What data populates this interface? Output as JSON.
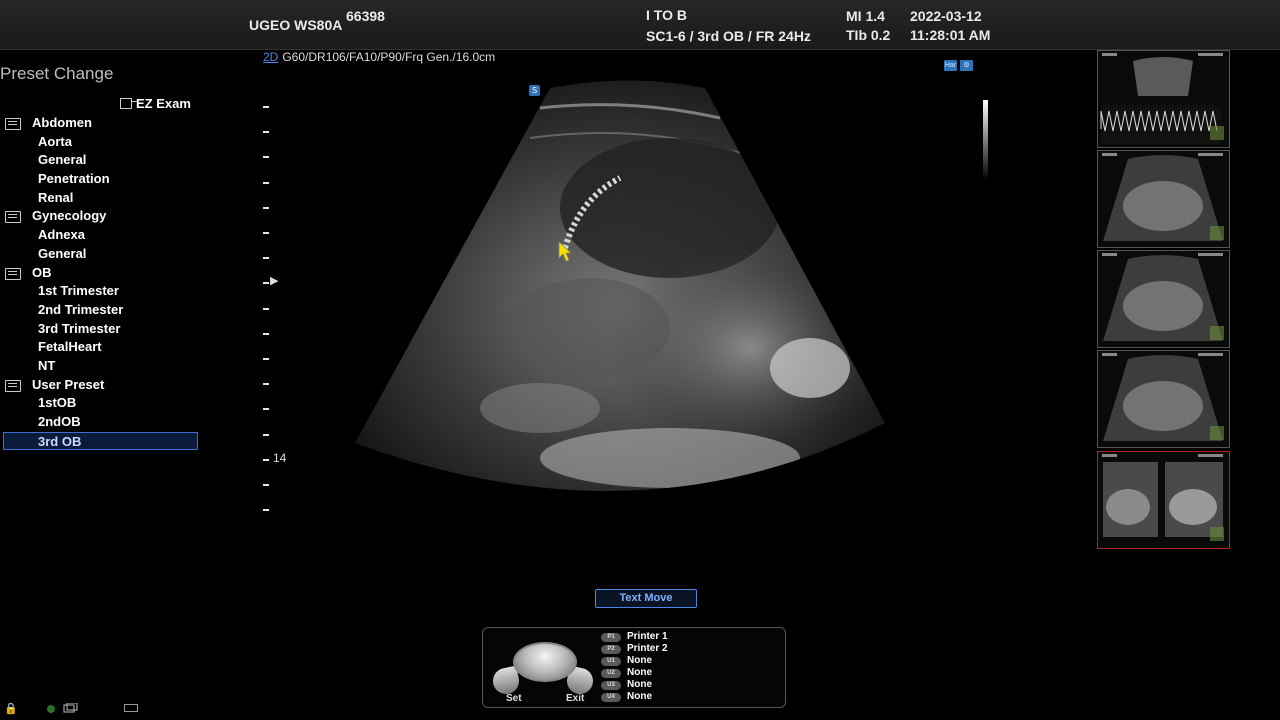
{
  "header": {
    "model": "UGEO WS80A",
    "patient_id": "66398",
    "transducer_mode": "I TO B",
    "probe_preset": "SC1-6 / 3rd OB / FR 24Hz",
    "mi": "MI  1.4",
    "tib": "TIb 0.2",
    "date": "2022-03-12",
    "time": "11:28:01 AM"
  },
  "preset_panel": {
    "title": "Preset Change",
    "ez_exam": "EZ Exam",
    "items": [
      {
        "label": "Abdomen",
        "type": "category"
      },
      {
        "label": "Aorta",
        "type": "sub"
      },
      {
        "label": "General",
        "type": "sub"
      },
      {
        "label": "Penetration",
        "type": "sub"
      },
      {
        "label": "Renal",
        "type": "sub"
      },
      {
        "label": "Gynecology",
        "type": "category"
      },
      {
        "label": "Adnexa",
        "type": "sub"
      },
      {
        "label": "General",
        "type": "sub"
      },
      {
        "label": "OB",
        "type": "category"
      },
      {
        "label": "1st Trimester",
        "type": "sub"
      },
      {
        "label": "2nd Trimester",
        "type": "sub"
      },
      {
        "label": "3rd Trimester",
        "type": "sub"
      },
      {
        "label": "FetalHeart",
        "type": "sub"
      },
      {
        "label": "NT",
        "type": "sub"
      },
      {
        "label": "User Preset",
        "type": "category"
      },
      {
        "label": "1stOB",
        "type": "sub"
      },
      {
        "label": "2ndOB",
        "type": "sub"
      },
      {
        "label": "3rd OB",
        "type": "sub",
        "selected": true
      }
    ]
  },
  "image_header": {
    "mode": "2D",
    "params": "G60/DR106/FA10/P90/Frq Gen./16.0cm"
  },
  "depth_scale": {
    "label": "14"
  },
  "text_move_button": "Text Move",
  "trackball_panel": {
    "set": "Set",
    "exit": "Exit",
    "keys": [
      {
        "pill": "P1",
        "label": "Printer 1"
      },
      {
        "pill": "P2",
        "label": "Printer 2"
      },
      {
        "pill": "U1",
        "label": "None"
      },
      {
        "pill": "U2",
        "label": "None"
      },
      {
        "pill": "U3",
        "label": "None"
      },
      {
        "pill": "U4",
        "label": "None"
      }
    ]
  },
  "thumbnails": [
    {
      "type": "doppler"
    },
    {
      "type": "bmode"
    },
    {
      "type": "bmode"
    },
    {
      "type": "bmode"
    },
    {
      "type": "dual",
      "active": true
    }
  ],
  "colors": {
    "accent": "#4f86e6",
    "selection_border": "#3b6fd6",
    "active_thumb_border": "#b2201f",
    "cursor": "#f5e000"
  }
}
